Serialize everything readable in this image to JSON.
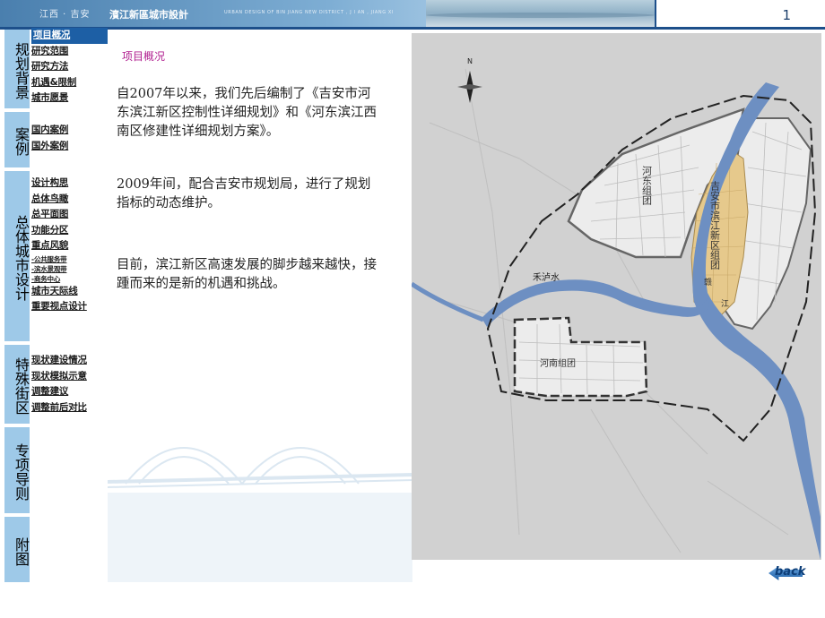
{
  "header": {
    "logo_text": "江西 · 吉安",
    "project_title": "濱江新區城市設計",
    "english_title": "URBAN DESIGN OF BIN JIANG NEW DISTRICT  , J I AN  , JIANG XI",
    "page_number": "1"
  },
  "nav": {
    "categories": [
      {
        "label": "规划背景",
        "items": [
          "项目概况",
          "研究范围",
          "研究方法",
          "机遇&限制",
          "城市愿景"
        ],
        "active": "项目概况"
      },
      {
        "label": "案例",
        "items": [
          "国内案例",
          "国外案例"
        ]
      },
      {
        "label": "总体城市设计",
        "items": [
          "设计构思",
          "总体鸟瞰",
          "总平面图",
          "功能分区",
          "重点风貌",
          "-公共服务带",
          "-滨水景观带",
          "-商务中心",
          "城市天际线",
          "重要视点设计"
        ]
      },
      {
        "label": "特殊街区",
        "items": [
          "现状建设情况",
          "现状模拟示意",
          "调整建议",
          "调整前后对比"
        ]
      },
      {
        "label": "专项导则",
        "items": []
      },
      {
        "label": "附图",
        "items": []
      }
    ]
  },
  "content": {
    "section_title": "项目概况",
    "paragraphs": [
      "自2007年以来，我们先后编制了《吉安市河东滨江新区控制性详细规划》和《河东滨江西南区修建性详细规划方案》。",
      "2009年间，配合吉安市规划局，进行了规划指标的动态维护。",
      "目前，滨江新区高速发展的脚步越来越快，接踵而来的是新的机遇和挑战。"
    ]
  },
  "map": {
    "north_label": "N",
    "labels": {
      "hedong": "河东组团",
      "binjiang": "吉安市滨江新区组团",
      "henan": "河南组团",
      "heluo_river": "禾泸水",
      "gan_1": "赣",
      "gan_2": "江"
    },
    "colors": {
      "river": "#6d8fc2",
      "highlight": "#e6c98c",
      "background": "#d1d1d1"
    }
  },
  "footer": {
    "back_label": "back"
  }
}
